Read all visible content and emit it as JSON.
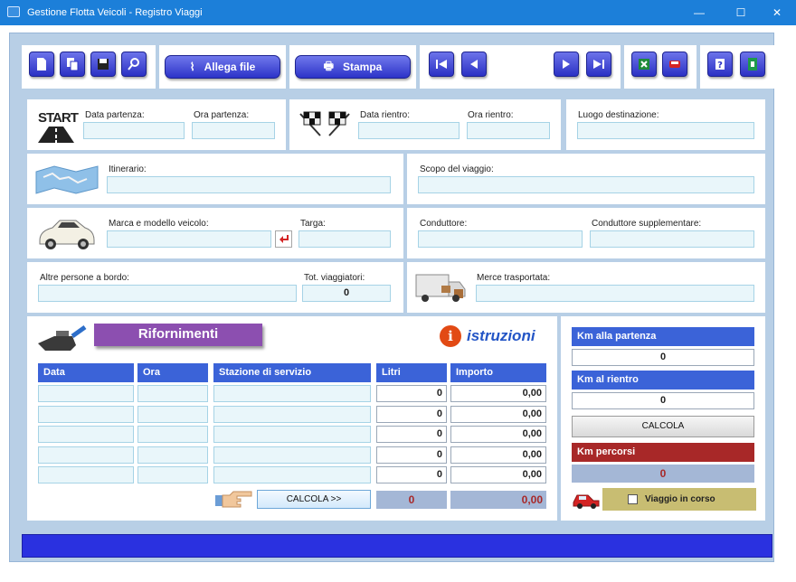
{
  "window": {
    "title": "Gestione Flotta Veicoli - Registro Viaggi",
    "minimize": "—",
    "maximize": "☐",
    "close": "✕"
  },
  "toolbar": {
    "attach_label": "Allega file",
    "print_label": "Stampa",
    "icons": [
      "new-icon",
      "copy-icon",
      "save-icon",
      "search-icon",
      "paperclip-icon",
      "printer-icon",
      "first-icon",
      "prev-icon",
      "next-icon",
      "last-icon",
      "excel-icon",
      "car-report-icon",
      "help-icon",
      "exit-icon"
    ]
  },
  "trip": {
    "start_logo": "START",
    "data_partenza": "Data partenza:",
    "ora_partenza": "Ora partenza:",
    "data_rientro": "Data rientro:",
    "ora_rientro": "Ora rientro:",
    "luogo": "Luogo destinazione:",
    "itinerario": "Itinerario:",
    "scopo": "Scopo del viaggio:",
    "marca": "Marca e modello veicolo:",
    "targa": "Targa:",
    "conduttore": "Conduttore:",
    "conduttore_supp": "Conduttore supplementare:",
    "altre_persone": "Altre persone a bordo:",
    "tot_viaggiatori": "Tot. viaggiatori:",
    "tot_value": "0",
    "merce": "Merce trasportata:"
  },
  "refuel": {
    "title": "Rifornimenti",
    "istruzioni": "istruzioni",
    "headers": [
      "Data",
      "Ora",
      "Stazione di servizio",
      "Litri",
      "Importo"
    ],
    "rows": [
      {
        "litri": "0",
        "importo": "0,00"
      },
      {
        "litri": "0",
        "importo": "0,00"
      },
      {
        "litri": "0",
        "importo": "0,00"
      },
      {
        "litri": "0",
        "importo": "0,00"
      },
      {
        "litri": "0",
        "importo": "0,00"
      }
    ],
    "calc_label": "CALCOLA  >>",
    "tot_litri": "0",
    "tot_importo": "0,00"
  },
  "km": {
    "partenza_label": "Km alla partenza",
    "partenza_value": "0",
    "rientro_label": "Km al rientro",
    "rientro_value": "0",
    "calc_label": "CALCOLA",
    "percorsi_label": "Km percorsi",
    "percorsi_value": "0",
    "in_corso_label": "Viaggio in corso"
  },
  "colors": {
    "title_bar": "#1c7fd9",
    "accent": "#3b63d8",
    "panel_bg": "#b8cfe6",
    "km_percorsi": "#a82828",
    "status_bar": "#2a31e0",
    "viaggio_bg": "#c8bd72",
    "rifornimenti_bg": "#8c4fb0"
  }
}
